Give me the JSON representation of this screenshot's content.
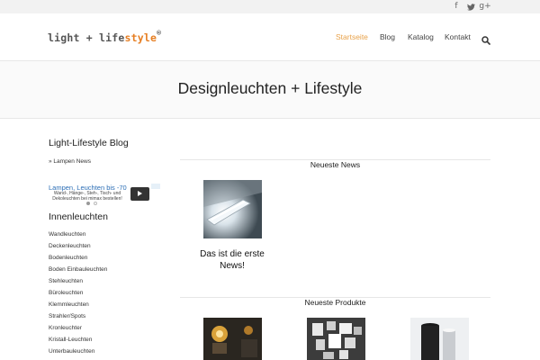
{
  "social": {
    "facebook": "f",
    "twitter": "•",
    "googleplus": "g+"
  },
  "header": {
    "logo": {
      "part1": "light + life",
      "part2": "style",
      "trademark": "®"
    },
    "nav": [
      "Startseite",
      "Blog",
      "Katalog",
      "Kontakt"
    ],
    "active_color": "#e8a24a"
  },
  "hero": {
    "title": "Designleuchten + Lifestyle"
  },
  "sidebar": {
    "blog_title": "Light-Lifestyle Blog",
    "blog_link": "» Lampen News",
    "ad": {
      "headline": "Lampen, Leuchten bis -70",
      "body": "Wand-, Hänge-, Steh-, Tisch- und Dekoleuchten bei mimax bestellen!"
    },
    "category_title": "Innenleuchten",
    "categories": [
      "Wandleuchten",
      "Deckenleuchten",
      "Bodenleuchten",
      "Boden Einbauleuchten",
      "Stehleuchten",
      "Büroleuchten",
      "Klemmleuchten",
      "Strahler/Spots",
      "Kronleuchter",
      "Kristall-Leuchten",
      "Unterbauleuchten"
    ]
  },
  "main": {
    "news_heading": "Neueste News",
    "news_item_title": "Das ist die erste News!",
    "products_heading": "Neueste Produkte"
  }
}
